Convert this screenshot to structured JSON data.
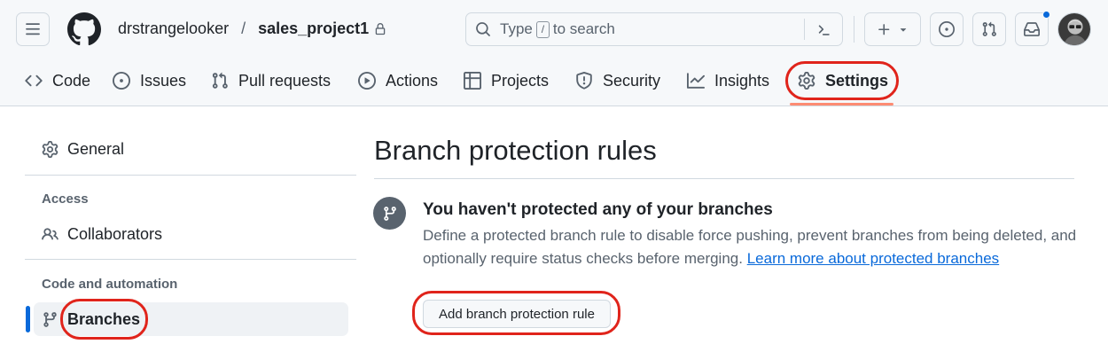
{
  "header": {
    "owner": "drstrangelooker",
    "separator": "/",
    "repo": "sales_project1",
    "search": {
      "before": "Type",
      "key": "/",
      "after": "to search"
    }
  },
  "nav": {
    "items": [
      {
        "label": "Code",
        "icon": "code-icon"
      },
      {
        "label": "Issues",
        "icon": "issue-icon"
      },
      {
        "label": "Pull requests",
        "icon": "pull-request-icon"
      },
      {
        "label": "Actions",
        "icon": "play-icon"
      },
      {
        "label": "Projects",
        "icon": "table-icon"
      },
      {
        "label": "Security",
        "icon": "shield-icon"
      },
      {
        "label": "Insights",
        "icon": "graph-icon"
      },
      {
        "label": "Settings",
        "icon": "gear-icon",
        "selected": true
      }
    ]
  },
  "sidebar": {
    "general": "General",
    "access_heading": "Access",
    "collaborators": "Collaborators",
    "code_heading": "Code and automation",
    "branches": "Branches"
  },
  "main": {
    "title": "Branch protection rules",
    "empty_title": "You haven't protected any of your branches",
    "empty_desc": "Define a protected branch rule to disable force pushing, prevent branches from being deleted, and optionally require status checks before merging.",
    "learn_more": "Learn more about protected branches",
    "add_button": "Add branch protection rule"
  },
  "colors": {
    "accent": "#0969da",
    "highlight_ring": "#e0241b",
    "selected_underline": "#fd8c73"
  }
}
